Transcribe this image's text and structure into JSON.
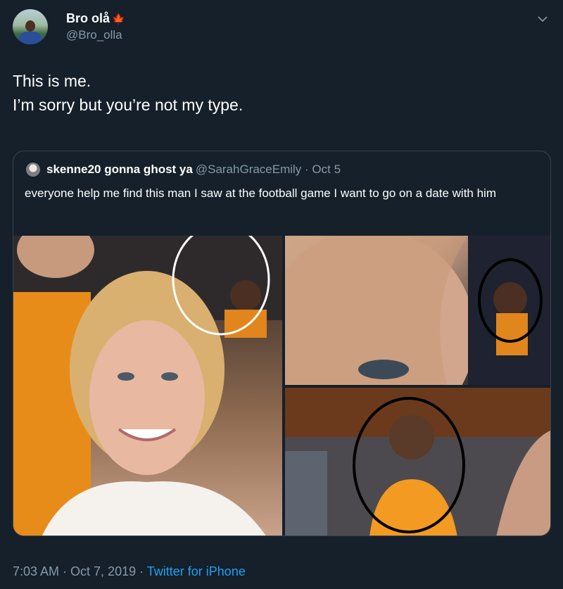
{
  "author": {
    "display_name": "Bro olå",
    "name_emoji": "🍁",
    "handle": "@Bro_olla",
    "avatar_icon": "profile-photo"
  },
  "tweet": {
    "text_lines": [
      "This is me.",
      "I’m sorry but you’re not my type."
    ]
  },
  "quoted_tweet": {
    "display_name": "skenne20 gonna ghost ya",
    "handle_and_date": "@SarahGraceEmily · Oct 5",
    "text": "everyone help me find this man I saw at the football game I want to go on a date with him",
    "photos": [
      "selfie-with-circled-man",
      "closeup-with-circled-man",
      "man-in-orange-shirt-circled"
    ]
  },
  "footer": {
    "time_date": "7:03 AM · Oct 7, 2019 · ",
    "source": "Twitter for iPhone"
  },
  "colors": {
    "background": "#15202b",
    "secondary_text": "#8899a6",
    "link": "#1da1f2",
    "border": "#38444d"
  }
}
